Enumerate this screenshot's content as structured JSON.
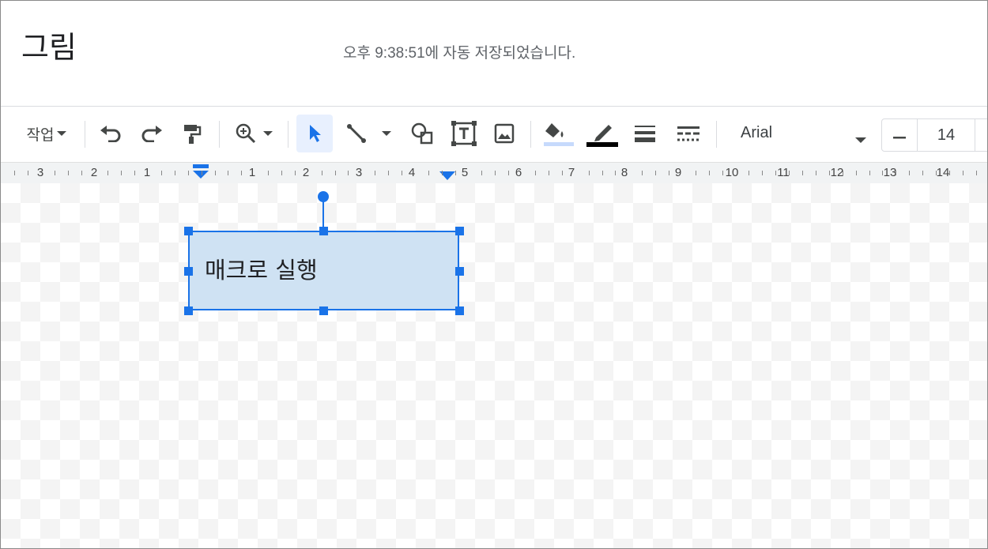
{
  "header": {
    "doc_title": "그림",
    "save_status": "오후 9:38:51에 자동 저장되었습니다."
  },
  "toolbar": {
    "actions_menu": "작업",
    "font_name": "Arial",
    "font_size": "14",
    "fill_color": "#c6dafc",
    "line_color": "#000000",
    "tools": [
      "undo-icon",
      "redo-icon",
      "paint-format-icon",
      "zoom-icon",
      "select-icon",
      "line-icon",
      "shape-icon",
      "text-box-icon",
      "image-icon",
      "fill-color-icon",
      "border-color-icon",
      "border-weight-icon",
      "border-dash-icon"
    ]
  },
  "ruler": {
    "labels": [
      "3",
      "2",
      "1",
      "1",
      "2",
      "3",
      "4",
      "5",
      "6",
      "7",
      "8",
      "9",
      "10",
      "11",
      "12",
      "13",
      "14"
    ]
  },
  "canvas": {
    "shape_text": "매크로 실행",
    "shape_fill": "#cfe2f3",
    "selection_color": "#1a73e8"
  }
}
